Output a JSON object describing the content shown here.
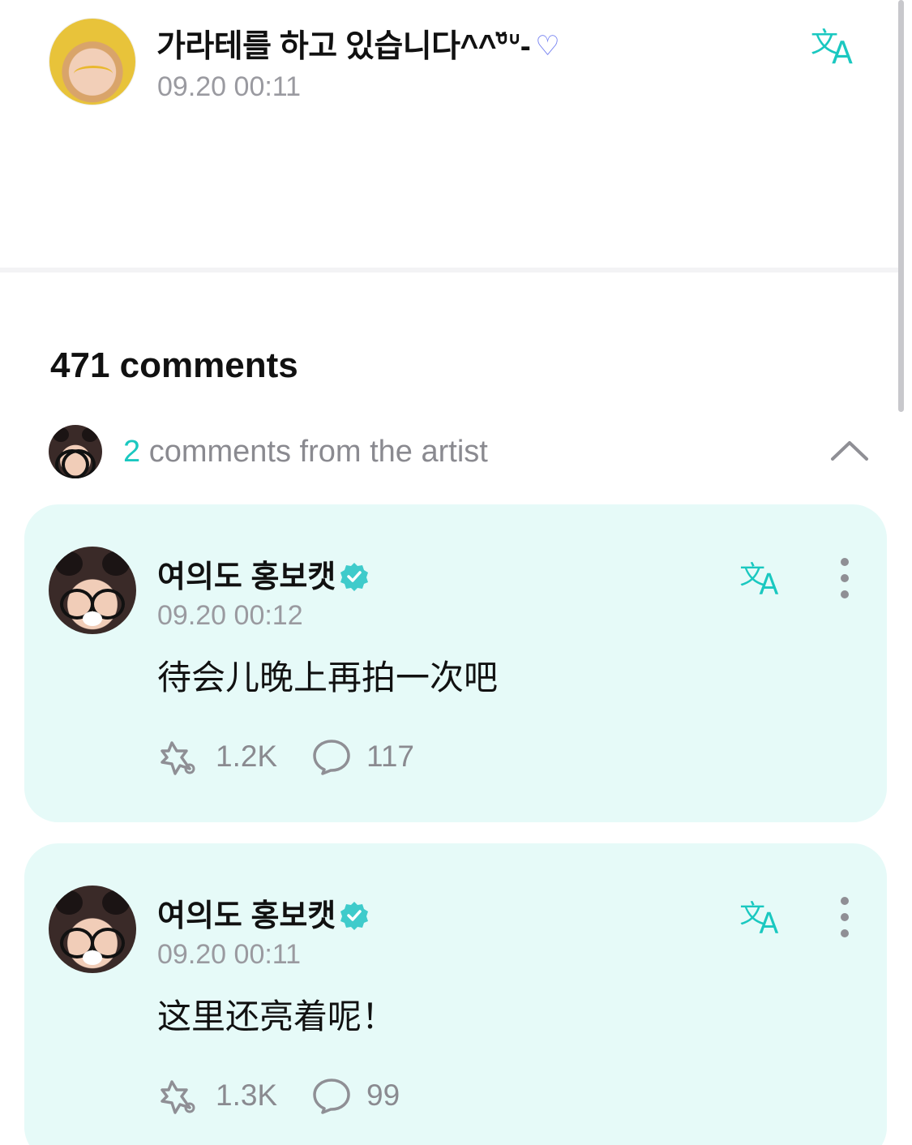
{
  "post": {
    "title": "가라테를 하고 있습니다^^ᐡ̆̈ᐡ-",
    "date": "09.20 00:11"
  },
  "comments_section": {
    "count_label": "471 comments",
    "artist_count": "2",
    "artist_label": "comments from the artist"
  },
  "artist_comments": [
    {
      "author": "여의도 홍보캣",
      "date": "09.20 00:12",
      "text": "待会儿晚上再拍一次吧",
      "likes": "1.2K",
      "replies": "117"
    },
    {
      "author": "여의도 홍보캣",
      "date": "09.20 00:11",
      "text": "这里还亮着呢！",
      "likes": "1.3K",
      "replies": "99"
    }
  ],
  "colors": {
    "accent": "#1ac8c0",
    "card_background": "#e6faf8",
    "secondary_text": "#9a9aa0",
    "heart": "#6f7cf0"
  },
  "icons": {
    "translate": "translate-icon",
    "verified": "verified-badge-icon",
    "more": "more-vertical-icon",
    "like": "sparkle-like-icon",
    "reply": "speech-bubble-icon",
    "collapse": "chevron-up-icon",
    "heart": "heart-icon"
  }
}
